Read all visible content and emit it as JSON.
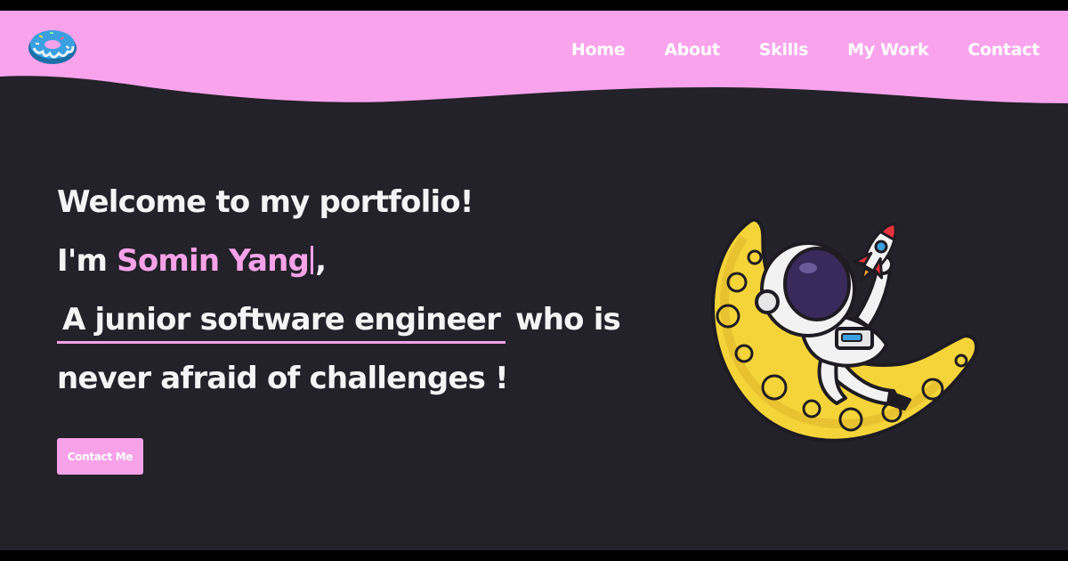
{
  "header": {
    "background_color": "#f9a3ec",
    "logo": "donut-logo",
    "nav": [
      {
        "label": "Home"
      },
      {
        "label": "About"
      },
      {
        "label": "Skills"
      },
      {
        "label": "My Work"
      },
      {
        "label": "Contact"
      }
    ]
  },
  "hero": {
    "welcome": "Welcome to my portfolio!",
    "intro_prefix": "I'm",
    "name": "Somin Yang",
    "intro_suffix": ",",
    "role": "A junior software engineer",
    "role_suffix": "who is",
    "line4": "never afraid of challenges !",
    "contact_button": "Contact Me"
  },
  "colors": {
    "background": "#232129",
    "accent": "#f7a2e8",
    "text": "#f4f4f4"
  },
  "illustration": "astronaut-on-moon-with-rocket"
}
